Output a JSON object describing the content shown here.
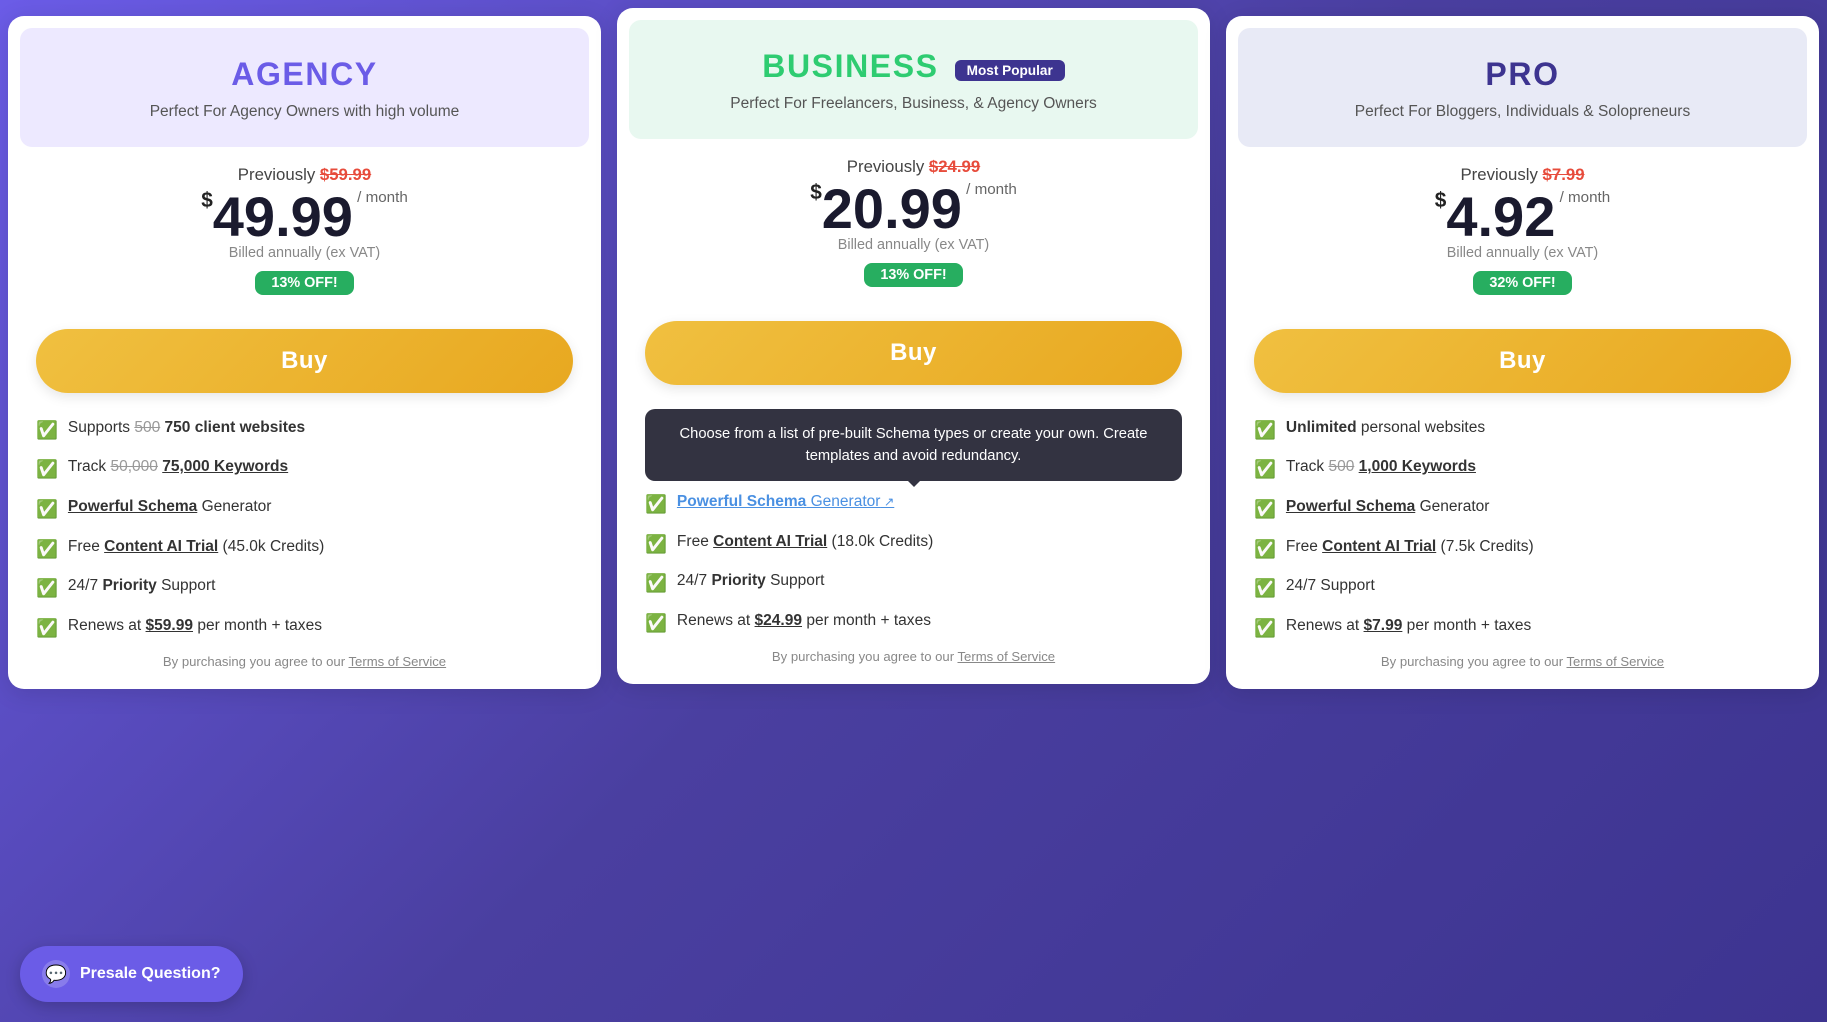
{
  "cards": [
    {
      "id": "agency",
      "headerClass": "agency",
      "titleClass": "agency",
      "title": "AGENCY",
      "mostPopular": false,
      "subtitle": "Perfect For Agency Owners with high volume",
      "previously": "Previously",
      "oldPrice": "$59.99",
      "priceDollar": "$",
      "priceAmount": "49.99",
      "pricePeriod": "/ month",
      "billedAnnually": "Billed annually (ex VAT)",
      "discount": "13% OFF!",
      "buyLabel": "Buy",
      "features": [
        {
          "text": "Supports ",
          "strikethrough": "500",
          "bold": "750 client websites",
          "rest": ""
        },
        {
          "text": "Track ",
          "strikethrough": "50,000",
          "bold": "75,000 Keywords",
          "rest": "",
          "underline": true
        },
        {
          "text": "",
          "bold": "Powerful Schema",
          "rest": " Generator",
          "underline": true
        },
        {
          "text": "Free ",
          "bold": "Content AI Trial",
          "rest": " (45.0k Credits)",
          "underline": true
        },
        {
          "text": "24/7 ",
          "bold": "Priority",
          "rest": " Support"
        },
        {
          "text": "Renews at ",
          "bold": "$59.99",
          "rest": " per month + taxes",
          "underline": true
        }
      ],
      "terms": "By purchasing you agree to our Terms of Service",
      "tooltip": null
    },
    {
      "id": "business",
      "headerClass": "business",
      "titleClass": "business",
      "title": "BUSINESS",
      "mostPopular": true,
      "mostPopularLabel": "Most Popular",
      "subtitle": "Perfect For Freelancers, Business, & Agency Owners",
      "previously": "Previously",
      "oldPrice": "$24.99",
      "priceDollar": "$",
      "priceAmount": "20.99",
      "pricePeriod": "/ month",
      "billedAnnually": "Billed annually (ex VAT)",
      "discount": "13% OFF!",
      "buyLabel": "Buy",
      "features": [
        {
          "text": "",
          "bold": "Powerful Schema",
          "rest": " Generator",
          "link": true,
          "linkExt": true
        },
        {
          "text": "Free ",
          "bold": "Content AI Trial",
          "rest": " (18.0k Credits)",
          "underline": true
        },
        {
          "text": "24/7 ",
          "bold": "Priority",
          "rest": " Support"
        },
        {
          "text": "Renews at ",
          "bold": "$24.99",
          "rest": " per month + taxes",
          "underline": true
        }
      ],
      "terms": "By purchasing you agree to our Terms of Service",
      "tooltip": "Choose from a list of pre-built Schema types or create your own. Create templates and avoid redundancy."
    },
    {
      "id": "pro",
      "headerClass": "pro",
      "titleClass": "pro",
      "title": "PRO",
      "mostPopular": false,
      "subtitle": "Perfect For Bloggers, Individuals & Solopreneurs",
      "previously": "Previously",
      "oldPrice": "$7.99",
      "priceDollar": "$",
      "priceAmount": "4.92",
      "pricePeriod": "/ month",
      "billedAnnually": "Billed annually (ex VAT)",
      "discount": "32% OFF!",
      "buyLabel": "Buy",
      "features": [
        {
          "text": "",
          "bold": "Unlimited",
          "rest": " personal websites"
        },
        {
          "text": "Track ",
          "strikethrough": "500",
          "bold": "1,000 Keywords",
          "rest": "",
          "underline": true
        },
        {
          "text": "",
          "bold": "Powerful Schema",
          "rest": " Generator",
          "underline": true
        },
        {
          "text": "Free ",
          "bold": "Content AI Trial",
          "rest": " (7.5k Credits)",
          "underline": true
        },
        {
          "text": "24/7 ",
          "bold": "",
          "rest": "Support"
        },
        {
          "text": "Renews at ",
          "bold": "$7.99",
          "rest": " per month + taxes",
          "underline": true
        }
      ],
      "terms": "By purchasing you agree to our Terms of Service"
    }
  ],
  "presale": {
    "label": "Presale Question?",
    "icon": "💬"
  }
}
